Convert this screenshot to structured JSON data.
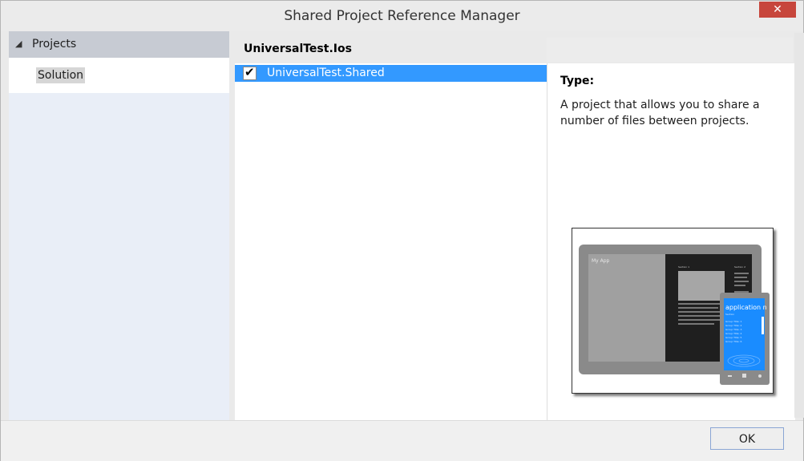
{
  "window": {
    "title": "Shared Project Reference Manager",
    "close_glyph": "✕"
  },
  "sidebar": {
    "header_arrow": "◢",
    "header_label": "Projects",
    "items": [
      {
        "label": "Solution",
        "selected": true
      }
    ]
  },
  "project_list": {
    "header": "UniversalTest.Ios",
    "items": [
      {
        "label": "UniversalTest.Shared",
        "checked": true,
        "selected": true,
        "check_glyph": "✔"
      }
    ]
  },
  "details": {
    "type_label": "Type:",
    "description": "A project that allows you to share a number of files between projects.",
    "preview": {
      "app_title": "My App",
      "section_label": "Section 1",
      "section_label_2": "Section 2",
      "phone_title": "application n",
      "phone_subtitle": "Section",
      "phone_items": [
        "Group Title: 1",
        "Group Title: 2",
        "Group Title: 3",
        "Group Title: 4",
        "Group Title: 5",
        "Group Title: 6"
      ]
    }
  },
  "footer": {
    "ok_label": "OK"
  },
  "colors": {
    "selection_blue": "#3399ff",
    "close_red": "#c7463c",
    "phone_blue": "#1a8cff"
  }
}
